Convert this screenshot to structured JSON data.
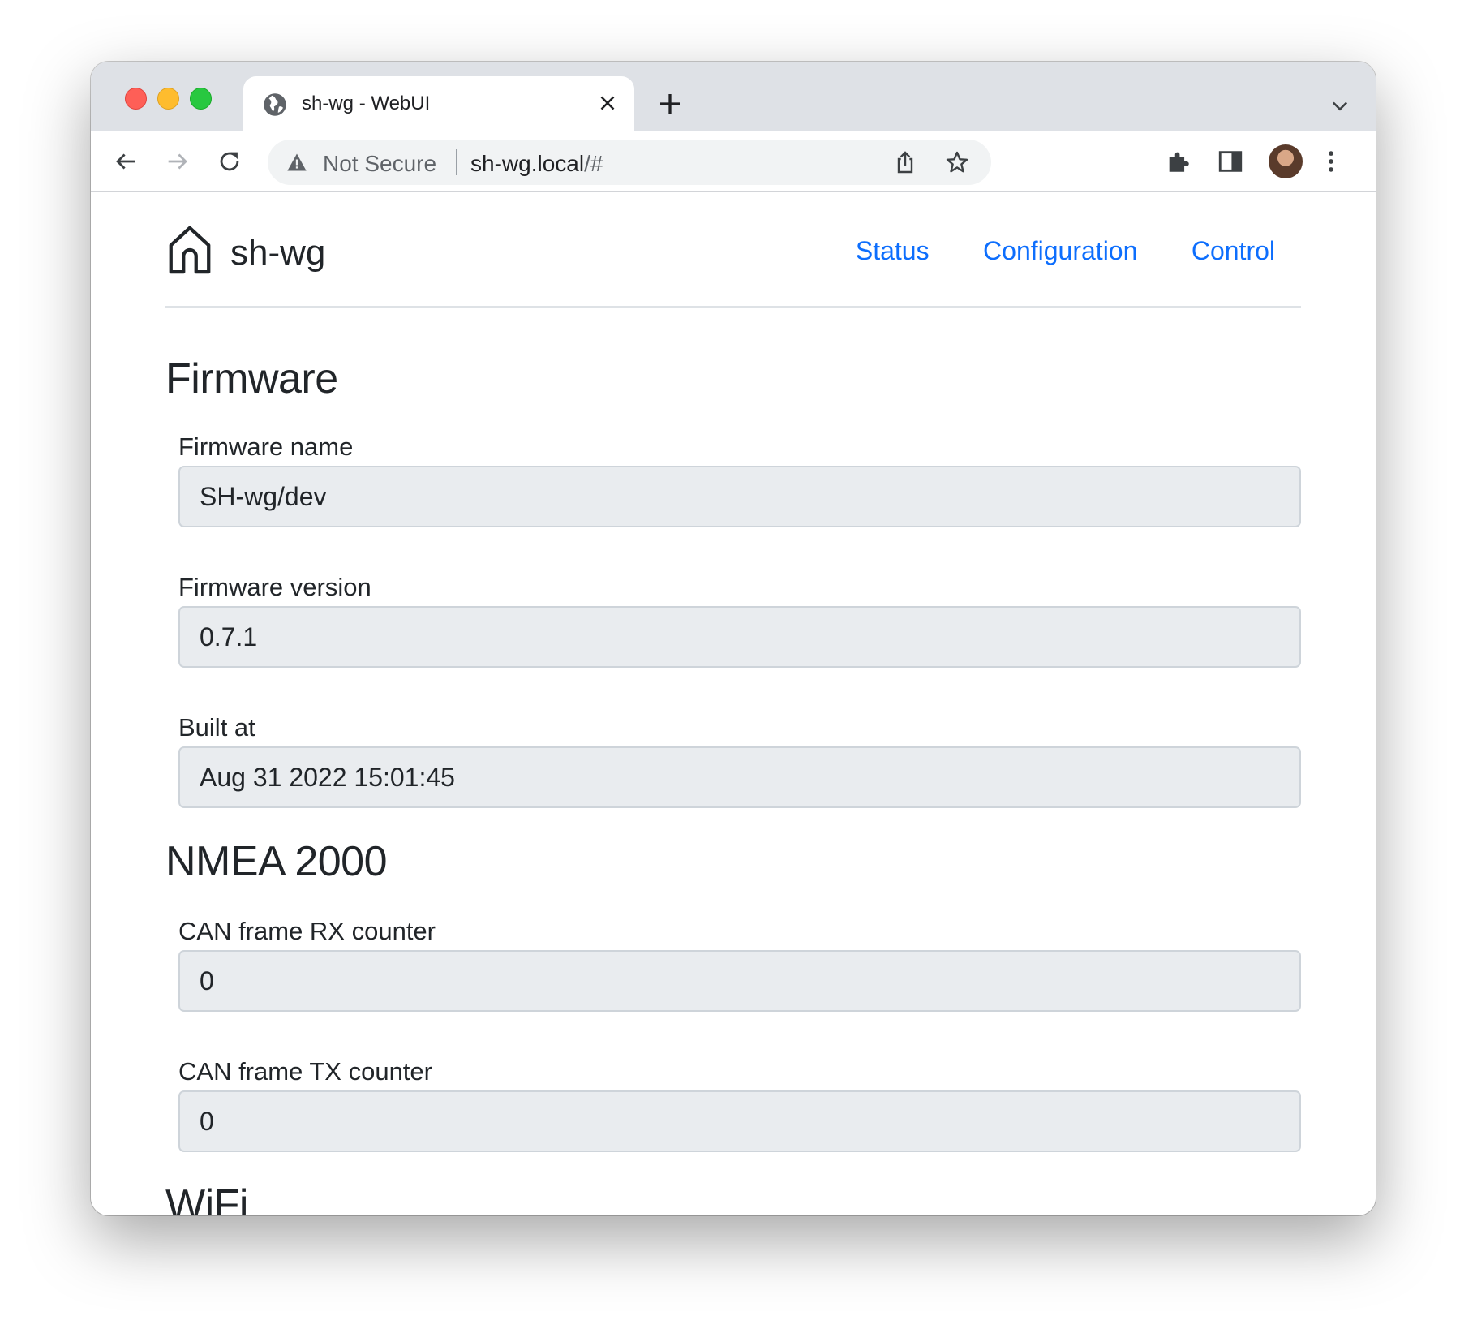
{
  "browser": {
    "tab_title": "sh-wg - WebUI",
    "security_label": "Not Secure",
    "url_host": "sh-wg.local",
    "url_path": "/#"
  },
  "header": {
    "brand": "sh-wg",
    "nav": [
      {
        "label": "Status"
      },
      {
        "label": "Configuration"
      },
      {
        "label": "Control"
      }
    ]
  },
  "sections": {
    "firmware": {
      "title": "Firmware",
      "fields": [
        {
          "label": "Firmware name",
          "value": "SH-wg/dev"
        },
        {
          "label": "Firmware version",
          "value": "0.7.1"
        },
        {
          "label": "Built at",
          "value": "Aug 31 2022 15:01:45"
        }
      ]
    },
    "nmea": {
      "title": "NMEA 2000",
      "fields": [
        {
          "label": "CAN frame RX counter",
          "value": "0"
        },
        {
          "label": "CAN frame TX counter",
          "value": "0"
        }
      ]
    },
    "wifi": {
      "title": "WiFi"
    }
  },
  "icons": {
    "tab_favicon": "globe-icon",
    "warning": "warning-triangle-icon",
    "brand": "home-icon"
  },
  "colors": {
    "link": "#0d6efd",
    "input_bg": "#e9ecef",
    "tabstrip_bg": "#dee1e6"
  }
}
